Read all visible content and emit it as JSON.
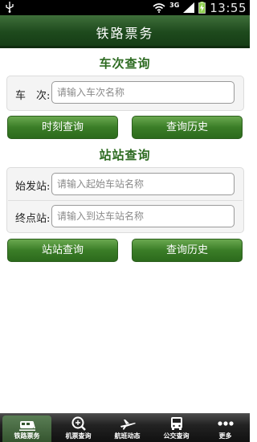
{
  "status_bar": {
    "network": "3G",
    "time": "13:55"
  },
  "header": {
    "title": "铁路票务"
  },
  "train_query": {
    "section_title": "车次查询",
    "train_label": "车　次:",
    "train_placeholder": "请输入车次名称",
    "schedule_button": "时刻查询",
    "history_button": "查询历史"
  },
  "station_query": {
    "section_title": "站站查询",
    "from_label": "始发站:",
    "from_placeholder": "请输入起始车站名称",
    "to_label": "终点站:",
    "to_placeholder": "请输入到达车站名称",
    "query_button": "站站查询",
    "history_button": "查询历史"
  },
  "tab_bar": {
    "tabs": [
      {
        "label": "铁路票务",
        "icon": "train-icon",
        "active": true
      },
      {
        "label": "机票查询",
        "icon": "plane-search-icon",
        "active": false
      },
      {
        "label": "航班动态",
        "icon": "airplane-icon",
        "active": false
      },
      {
        "label": "公交查询",
        "icon": "bus-icon",
        "active": false
      },
      {
        "label": "更多",
        "icon": "more-icon",
        "active": false
      }
    ]
  }
}
